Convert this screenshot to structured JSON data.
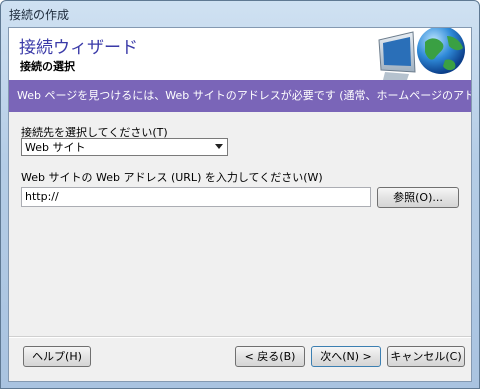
{
  "window": {
    "title": "接続の作成"
  },
  "header": {
    "title": "接続ウィザード",
    "subtitle": "接続の選択"
  },
  "banner": {
    "text": "Web ページを見つけるには、Web サイトのアドレスが必要です (通常、ホームページのアドレス)。"
  },
  "form": {
    "connect_label": "接続先を選択してください(T)",
    "connect_value": "Web サイト",
    "url_label": "Web サイトの Web アドレス (URL) を入力してください(W)",
    "url_value": "http://"
  },
  "buttons": {
    "browse": "参照(O)...",
    "help": "ヘルプ(H)",
    "back": "< 戻る(B)",
    "next": "次へ(N) >",
    "cancel": "キャンセル(C)"
  },
  "icons": {
    "header_graphic": "globe-monitor-icon",
    "dropdown": "chevron-down-icon"
  },
  "colors": {
    "banner": "#7a65b8",
    "header_title": "#3a3aa8"
  }
}
